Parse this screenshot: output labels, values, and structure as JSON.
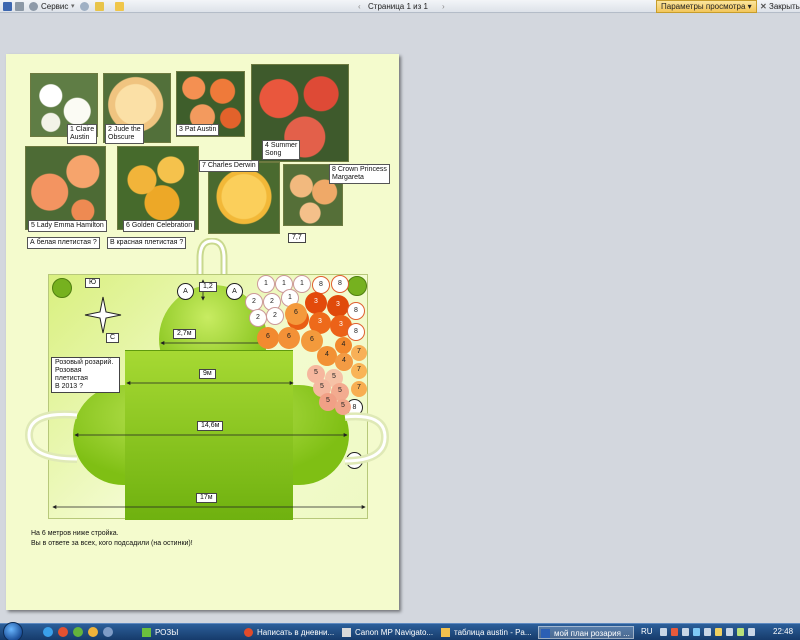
{
  "toolbar": {
    "service_label": "Сервис",
    "page_indicator": "Страница 1 из 1",
    "view_params_label": "Параметры просмотра",
    "close_label": "Закрыть"
  },
  "roses": [
    {
      "caption": "1 Claire\nAustin"
    },
    {
      "caption": "2 Jude the\nObscure"
    },
    {
      "caption": "3 Pat Austin"
    },
    {
      "caption": "4 Summer\nSong"
    },
    {
      "caption": "5 Lady Emma Hamilton"
    },
    {
      "caption": "6 Golden Celebration"
    },
    {
      "caption": "7 Charles Derwin"
    },
    {
      "caption": "8 Crown Princess\nMargareta"
    }
  ],
  "climbers": {
    "a": "А белая плетистая ?",
    "b": "В красная плетистая ?"
  },
  "plan": {
    "compass_north": "Ю",
    "compass_south": "С",
    "dim_top": "7,7",
    "dim_gap": "1,2",
    "dim_bulge": "2,7м",
    "dim_center": "9м",
    "dim_wide": "14,6м",
    "dim_total": "17м",
    "note": "Розовый розарий.\nРозовая плетистая\nВ 2013 ?",
    "marker_a": "А",
    "marker_b": "В",
    "bed_numbers": [
      "1",
      "1",
      "1",
      "8",
      "8",
      "2",
      "2",
      "1",
      "3",
      "3",
      "2",
      "2",
      "3",
      "8",
      "3",
      "3",
      "6",
      "6",
      "6",
      "6",
      "4",
      "8",
      "4",
      "4",
      "7",
      "5",
      "5",
      "5",
      "7",
      "5",
      "5",
      "7",
      "5",
      "8"
    ]
  },
  "footer": {
    "line1": "На 6 метров ниже стройка.",
    "line2": "Вы в ответе за всех, кого подсадили (на остинки)!"
  },
  "taskbar": {
    "items": [
      {
        "label": "РОЗЫ"
      },
      {
        "label": "Написать в дневни..."
      },
      {
        "label": "Canon MP Navigato..."
      },
      {
        "label": "таблица austin - Pa..."
      },
      {
        "label": "мой план розария ..."
      }
    ],
    "lang": "RU",
    "time": "22:48"
  },
  "colors": {
    "page_bg": "#f4fbcd",
    "lawn": "#8fcd2a",
    "taskbar": "#1f4c85"
  }
}
